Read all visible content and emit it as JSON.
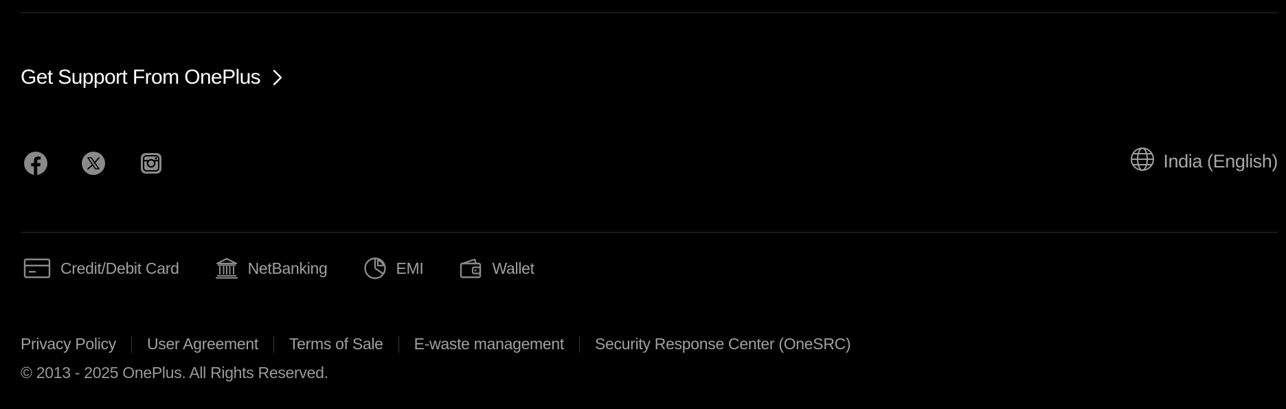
{
  "support": {
    "label": "Get Support From OnePlus",
    "icon": "chevron-right-icon"
  },
  "social": [
    {
      "name": "facebook",
      "icon": "facebook-icon"
    },
    {
      "name": "x",
      "icon": "x-twitter-icon"
    },
    {
      "name": "instagram",
      "icon": "instagram-icon"
    }
  ],
  "region": {
    "label": "India (English)",
    "icon": "globe-icon"
  },
  "payments": [
    {
      "label": "Credit/Debit Card",
      "icon": "credit-card-icon"
    },
    {
      "label": "NetBanking",
      "icon": "bank-icon"
    },
    {
      "label": "EMI",
      "icon": "pie-chart-icon"
    },
    {
      "label": "Wallet",
      "icon": "wallet-icon"
    }
  ],
  "legal": {
    "links": [
      "Privacy Policy",
      "User Agreement",
      "Terms of Sale",
      "E-waste management",
      "Security Response Center (OneSRC)"
    ],
    "copyright": "© 2013 - 2025 OnePlus. All Rights Reserved."
  },
  "colors": {
    "background": "#000000",
    "primary_text": "#ffffff",
    "secondary_text": "#a0a0a0",
    "icon_gray": "#8a8a8a",
    "divider": "#2c2c2c"
  }
}
